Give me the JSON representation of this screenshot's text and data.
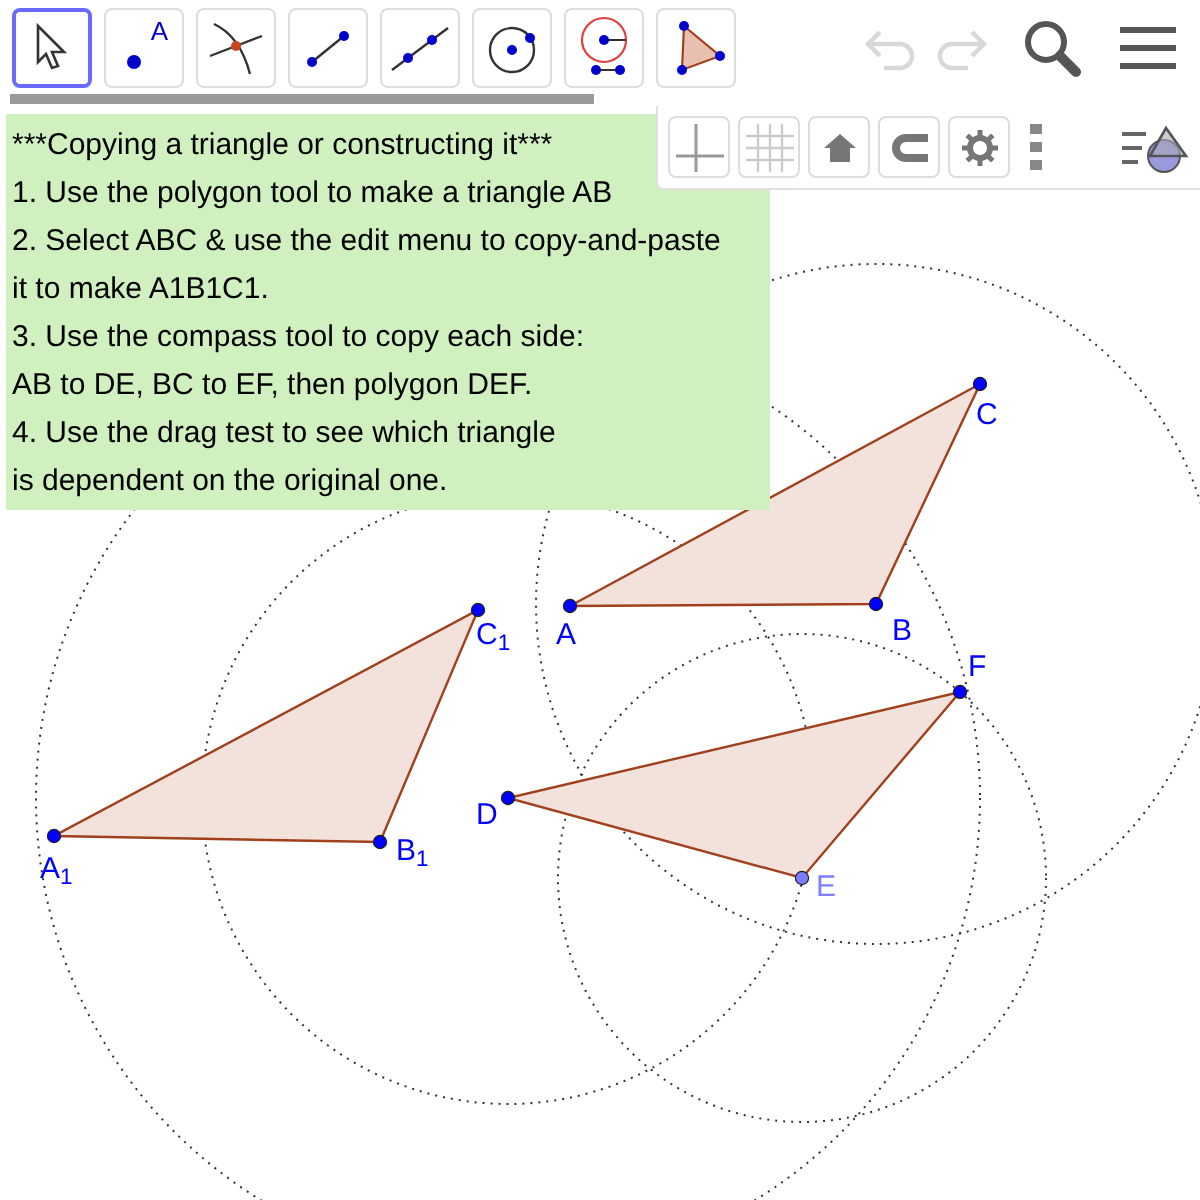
{
  "toolbar": {
    "tools": [
      {
        "kind": "move",
        "selected": true
      },
      {
        "kind": "point",
        "label": "A",
        "selected": false
      },
      {
        "kind": "intersect",
        "selected": false
      },
      {
        "kind": "segment",
        "selected": false
      },
      {
        "kind": "line",
        "selected": false
      },
      {
        "kind": "circle",
        "selected": false
      },
      {
        "kind": "compass",
        "selected": false
      },
      {
        "kind": "polygon",
        "selected": false
      }
    ],
    "undo_disabled": true
  },
  "text_box": {
    "lines": [
      "***Copying a triangle or constructing it***",
      "1. Use the polygon tool to make a triangle AB",
      "2. Select ABC & use the edit menu to copy-and-paste",
      "it to make A1B1C1.",
      "3. Use the compass tool to copy each side:",
      "AB to DE, BC to EF, then polygon DEF.",
      "4. Use the drag test to see which triangle",
      "is dependent on the original one."
    ]
  },
  "style_bar": {
    "axes_on": false,
    "grid_on": false
  },
  "canvas": {
    "points": [
      {
        "label": "A",
        "color": "#0000ff"
      },
      {
        "label": "B",
        "color": "#0000ff"
      },
      {
        "label": "C",
        "color": "#0000ff"
      },
      {
        "label": "A$_{1}$",
        "color": "#0000ff"
      },
      {
        "label": "B$_{1}$",
        "color": "#0000ff"
      },
      {
        "label": "C$_{1}$",
        "color": "#0000ff"
      },
      {
        "label": "D",
        "color": "#0000ff"
      },
      {
        "label": "E",
        "color": "#7d7dff"
      },
      {
        "label": "F",
        "color": "#0000ff"
      }
    ]
  }
}
